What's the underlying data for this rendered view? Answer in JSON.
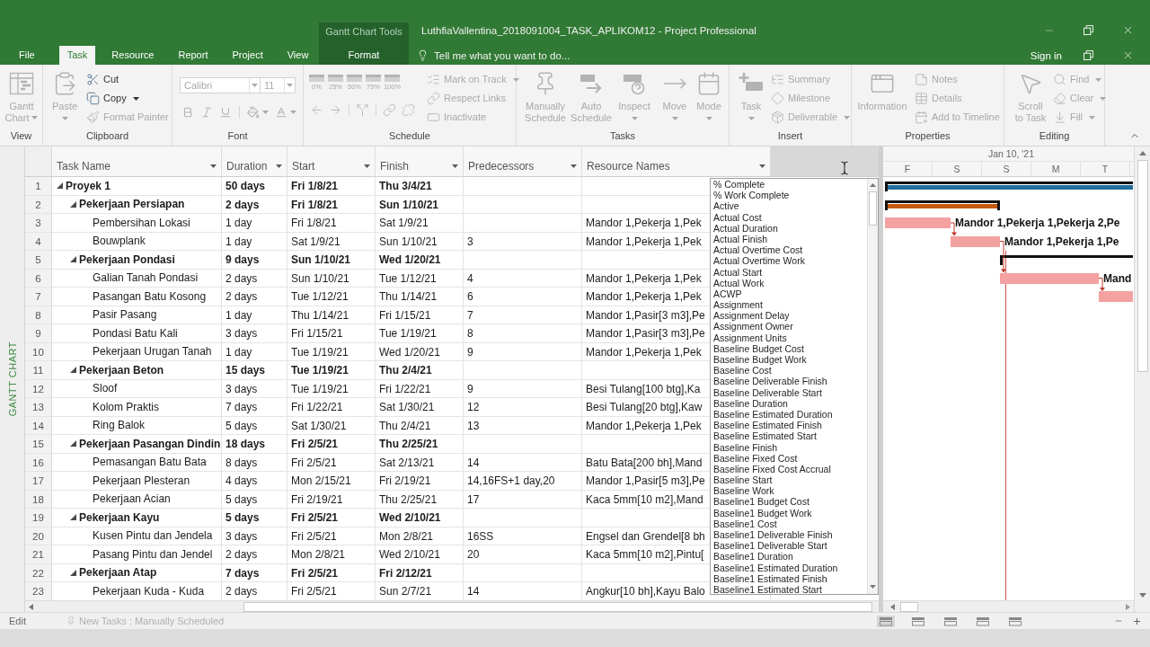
{
  "window": {
    "context_label": "Gantt Chart Tools",
    "title": "LuthfiaVallentina_2018091004_TASK_APLIKOM12 - Project Professional",
    "sign_in": "Sign in"
  },
  "tabs": [
    {
      "label": "File",
      "contextual": false,
      "selected": false
    },
    {
      "label": "Task",
      "contextual": false,
      "selected": true
    },
    {
      "label": "Resource",
      "contextual": false,
      "selected": false
    },
    {
      "label": "Report",
      "contextual": false,
      "selected": false
    },
    {
      "label": "Project",
      "contextual": false,
      "selected": false
    },
    {
      "label": "View",
      "contextual": false,
      "selected": false
    },
    {
      "label": "Format",
      "contextual": true,
      "selected": false
    }
  ],
  "tell_me": {
    "placeholder": "Tell me what you want to do..."
  },
  "ribbon": [
    {
      "label": "View",
      "commands": [
        {
          "label": "Gantt Chart",
          "kind": "large",
          "disabled": true,
          "dropdown": true
        }
      ]
    },
    {
      "label": "Clipboard",
      "commands": [
        {
          "label": "Paste",
          "kind": "large",
          "disabled": true,
          "dropdown": true
        },
        {
          "label": "Cut",
          "kind": "small",
          "disabled": false,
          "dropdown": false
        },
        {
          "label": "Copy",
          "kind": "small",
          "disabled": false,
          "dropdown": true
        },
        {
          "label": "Format Painter",
          "kind": "small",
          "disabled": true,
          "dropdown": false
        }
      ]
    },
    {
      "label": "Font",
      "fields": [
        {
          "value": "Calibri",
          "disabled": true
        },
        {
          "value": "11",
          "disabled": true
        }
      ],
      "buttons": [
        {
          "disabled": true,
          "dropdown": false
        },
        {
          "disabled": true,
          "dropdown": false
        },
        {
          "disabled": true,
          "dropdown": false
        },
        {
          "disabled": true,
          "dropdown": true
        },
        {
          "disabled": true,
          "dropdown": true
        }
      ]
    },
    {
      "label": "Schedule",
      "percent_buttons": [
        {
          "label": "0%",
          "disabled": true
        },
        {
          "label": "25%",
          "disabled": true
        },
        {
          "label": "50%",
          "disabled": true
        },
        {
          "label": "75%",
          "disabled": true
        },
        {
          "label": "100%",
          "disabled": true
        }
      ],
      "buttons": [
        {
          "disabled": true
        },
        {
          "disabled": true
        },
        {
          "disabled": true
        },
        {
          "disabled": true
        },
        {
          "disabled": true
        }
      ],
      "commands": [
        {
          "label": "Mark on Track",
          "kind": "small",
          "disabled": true,
          "dropdown": true
        },
        {
          "label": "Respect Links",
          "kind": "small",
          "disabled": true,
          "dropdown": false
        },
        {
          "label": "Inactivate",
          "kind": "small",
          "disabled": true,
          "dropdown": false
        }
      ]
    },
    {
      "label": "Tasks",
      "commands": [
        {
          "label": "Manually Schedule",
          "kind": "large",
          "disabled": true,
          "dropdown": false
        },
        {
          "label": "Auto Schedule",
          "kind": "large",
          "disabled": true,
          "dropdown": false
        },
        {
          "label": "Inspect",
          "kind": "large",
          "disabled": true,
          "dropdown": true
        },
        {
          "label": "Move",
          "kind": "large",
          "disabled": true,
          "dropdown": true
        },
        {
          "label": "Mode",
          "kind": "large",
          "disabled": true,
          "dropdown": true
        }
      ]
    },
    {
      "label": "Insert",
      "commands": [
        {
          "label": "Task",
          "kind": "large",
          "disabled": true,
          "dropdown": true
        },
        {
          "label": "Summary",
          "kind": "small",
          "disabled": true,
          "dropdown": false
        },
        {
          "label": "Milestone",
          "kind": "small",
          "disabled": true,
          "dropdown": false
        },
        {
          "label": "Deliverable",
          "kind": "small",
          "disabled": true,
          "dropdown": true
        }
      ]
    },
    {
      "label": "Properties",
      "commands": [
        {
          "label": "Information",
          "kind": "large",
          "disabled": true,
          "dropdown": false
        },
        {
          "label": "Notes",
          "kind": "small",
          "disabled": true,
          "dropdown": false
        },
        {
          "label": "Details",
          "kind": "small",
          "disabled": true,
          "dropdown": false
        },
        {
          "label": "Add to Timeline",
          "kind": "small",
          "disabled": true,
          "dropdown": false
        }
      ]
    },
    {
      "label": "Editing",
      "commands": [
        {
          "label": "Scroll to Task",
          "kind": "large",
          "disabled": true,
          "dropdown": false
        },
        {
          "label": "Find",
          "kind": "small",
          "disabled": true,
          "dropdown": true
        },
        {
          "label": "Clear",
          "kind": "small",
          "disabled": true,
          "dropdown": true
        },
        {
          "label": "Fill",
          "kind": "small",
          "disabled": true,
          "dropdown": true
        }
      ]
    }
  ],
  "view_bar": {
    "label": "GANTT CHART"
  },
  "table": {
    "columns": [
      {
        "label": "Task Name"
      },
      {
        "label": "Duration"
      },
      {
        "label": "Start"
      },
      {
        "label": "Finish"
      },
      {
        "label": "Predecessors"
      },
      {
        "label": "Resource Names"
      }
    ],
    "tasks": [
      {
        "id": "1",
        "name": "Proyek 1",
        "duration": "50 days",
        "start": "Fri 1/8/21",
        "finish": "Thu 3/4/21",
        "expanded": true,
        "bar": {
          "kind": "summary",
          "color": "#1f6e9e"
        },
        "children": [
          {
            "id": "2",
            "name": "Pekerjaan Persiapan",
            "duration": "2 days",
            "start": "Fri 1/8/21",
            "finish": "Sun 1/10/21",
            "expanded": true,
            "bar": {
              "kind": "summary",
              "color": "#c55a11"
            },
            "children": [
              {
                "id": "3",
                "name": "Pembersihan Lokasi",
                "duration": "1 day",
                "start": "Fri 1/8/21",
                "finish": "Sat 1/9/21",
                "resources": "Mandor 1,Pekerja 1,Pek",
                "bar": {
                  "kind": "task",
                  "label": "Mandor 1,Pekerja 1,Pekerja 2,Pe"
                }
              },
              {
                "id": "4",
                "name": "Bouwplank",
                "duration": "1 day",
                "start": "Sat 1/9/21",
                "finish": "Sun 1/10/21",
                "predecessors": "3",
                "resources": "Mandor 1,Pekerja 1,Pek",
                "bar": {
                  "kind": "task",
                  "label": "Mandor 1,Pekerja 1,Pe"
                }
              }
            ]
          },
          {
            "id": "5",
            "name": "Pekerjaan Pondasi",
            "duration": "9 days",
            "start": "Sun 1/10/21",
            "finish": "Wed 1/20/21",
            "expanded": true,
            "bar": {
              "kind": "summary"
            },
            "children": [
              {
                "id": "6",
                "name": "Galian Tanah Pondasi",
                "duration": "2 days",
                "start": "Sun 1/10/21",
                "finish": "Tue 1/12/21",
                "predecessors": "4",
                "resources": "Mandor 1,Pekerja 1,Pek",
                "bar": {
                  "kind": "task",
                  "label": "Mand"
                }
              },
              {
                "id": "7",
                "name": "Pasangan Batu Kosong",
                "duration": "2 days",
                "start": "Tue 1/12/21",
                "finish": "Thu 1/14/21",
                "predecessors": "6",
                "resources": "Mandor 1,Pekerja 1,Pek",
                "bar": {
                  "kind": "task"
                }
              },
              {
                "id": "8",
                "name": "Pasir Pasang",
                "duration": "1 day",
                "start": "Thu 1/14/21",
                "finish": "Fri 1/15/21",
                "predecessors": "7",
                "resources": "Mandor 1,Pasir[3 m3],Pe"
              },
              {
                "id": "9",
                "name": "Pondasi Batu Kali",
                "duration": "3 days",
                "start": "Fri 1/15/21",
                "finish": "Tue 1/19/21",
                "predecessors": "8",
                "resources": "Mandor 1,Pasir[3 m3],Pe"
              },
              {
                "id": "10",
                "name": "Pekerjaan Urugan Tanah",
                "duration": "1 day",
                "start": "Tue 1/19/21",
                "finish": "Wed 1/20/21",
                "predecessors": "9",
                "resources": "Mandor 1,Pekerja 1,Pek"
              }
            ]
          },
          {
            "id": "11",
            "name": "Pekerjaan Beton",
            "duration": "15 days",
            "start": "Tue 1/19/21",
            "finish": "Thu 2/4/21",
            "expanded": true,
            "children": [
              {
                "id": "12",
                "name": "Sloof",
                "duration": "3 days",
                "start": "Tue 1/19/21",
                "finish": "Fri 1/22/21",
                "predecessors": "9",
                "resources": "Besi Tulang[100 btg],Ka"
              },
              {
                "id": "13",
                "name": "Kolom Praktis",
                "duration": "7 days",
                "start": "Fri 1/22/21",
                "finish": "Sat 1/30/21",
                "predecessors": "12",
                "resources": "Besi Tulang[20 btg],Kaw"
              },
              {
                "id": "14",
                "name": "Ring Balok",
                "duration": "5 days",
                "start": "Sat 1/30/21",
                "finish": "Thu 2/4/21",
                "predecessors": "13",
                "resources": "Mandor 1,Pekerja 1,Pek"
              }
            ]
          },
          {
            "id": "15",
            "name": "Pekerjaan Pasangan Dindin",
            "duration": "18 days",
            "start": "Fri 2/5/21",
            "finish": "Thu 2/25/21",
            "expanded": true,
            "children": [
              {
                "id": "16",
                "name": "Pemasangan Batu Bata",
                "duration": "8 days",
                "start": "Fri 2/5/21",
                "finish": "Sat 2/13/21",
                "predecessors": "14",
                "resources": "Batu Bata[200 bh],Mand"
              },
              {
                "id": "17",
                "name": "Pekerjaan Plesteran",
                "duration": "4 days",
                "start": "Mon 2/15/21",
                "finish": "Fri 2/19/21",
                "predecessors": "14,16FS+1 day,20",
                "resources": "Mandor 1,Pasir[5 m3],Pe"
              },
              {
                "id": "18",
                "name": "Pekerjaan Acian",
                "duration": "5 days",
                "start": "Fri 2/19/21",
                "finish": "Thu 2/25/21",
                "predecessors": "17",
                "resources": "Kaca 5mm[10 m2],Mand"
              }
            ]
          },
          {
            "id": "19",
            "name": "Pekerjaan Kayu",
            "duration": "5 days",
            "start": "Fri 2/5/21",
            "finish": "Wed 2/10/21",
            "expanded": true,
            "children": [
              {
                "id": "20",
                "name": "Kusen Pintu dan Jendela",
                "duration": "3 days",
                "start": "Fri 2/5/21",
                "finish": "Mon 2/8/21",
                "predecessors": "16SS",
                "resources": "Engsel dan Grendel[8 bh"
              },
              {
                "id": "21",
                "name": "Pasang Pintu dan Jendel",
                "duration": "2 days",
                "start": "Mon 2/8/21",
                "finish": "Wed 2/10/21",
                "predecessors": "20",
                "resources": "Kaca 5mm[10 m2],Pintu["
              }
            ]
          },
          {
            "id": "22",
            "name": "Pekerjaan Atap",
            "duration": "7 days",
            "start": "Fri 2/5/21",
            "finish": "Fri 2/12/21",
            "expanded": true,
            "children": [
              {
                "id": "23",
                "name": "Pekerjaan Kuda - Kuda",
                "duration": "2 days",
                "start": "Fri 2/5/21",
                "finish": "Sun 2/7/21",
                "predecessors": "14",
                "resources": "Angkur[10 bh],Kayu Balo"
              }
            ]
          }
        ]
      }
    ]
  },
  "column_picker": {
    "options": [
      "% Complete",
      "% Work Complete",
      "Active",
      "Actual Cost",
      "Actual Duration",
      "Actual Finish",
      "Actual Overtime Cost",
      "Actual Overtime Work",
      "Actual Start",
      "Actual Work",
      "ACWP",
      "Assignment",
      "Assignment Delay",
      "Assignment Owner",
      "Assignment Units",
      "Baseline Budget Cost",
      "Baseline Budget Work",
      "Baseline Cost",
      "Baseline Deliverable Finish",
      "Baseline Deliverable Start",
      "Baseline Duration",
      "Baseline Estimated Duration",
      "Baseline Estimated Finish",
      "Baseline Estimated Start",
      "Baseline Finish",
      "Baseline Fixed Cost",
      "Baseline Fixed Cost Accrual",
      "Baseline Start",
      "Baseline Work",
      "Baseline1 Budget Cost",
      "Baseline1 Budget Work",
      "Baseline1 Cost",
      "Baseline1 Deliverable Finish",
      "Baseline1 Deliverable Start",
      "Baseline1 Duration",
      "Baseline1 Estimated Duration",
      "Baseline1 Estimated Finish",
      "Baseline1 Estimated Start"
    ]
  },
  "gantt": {
    "week_label": "Jan 10, '21",
    "days": [
      "F",
      "S",
      "S",
      "M",
      "T"
    ]
  },
  "status_bar": {
    "mode": "Edit",
    "new_tasks": "New Tasks : Manually Scheduled",
    "view_buttons": [
      {
        "selected": true
      },
      {
        "selected": false
      },
      {
        "selected": false
      },
      {
        "selected": false
      },
      {
        "selected": false
      }
    ]
  }
}
